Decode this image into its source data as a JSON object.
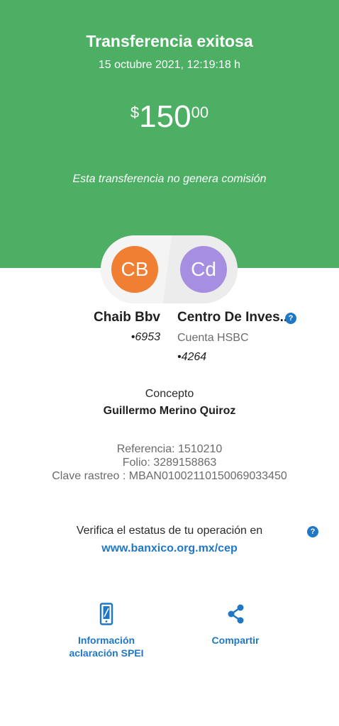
{
  "header": {
    "title": "Transferencia exitosa",
    "date": "15 octubre 2021, 12:19:18 h",
    "amount": {
      "currency": "$",
      "integer": "150",
      "decimal": "00"
    },
    "commission_note": "Esta transferencia no genera comisión",
    "bg_color": "#4caf64"
  },
  "sender": {
    "initials": "CB",
    "name": "Chaib Bbv",
    "account": "•6953",
    "avatar_color": "#f07e33"
  },
  "recipient": {
    "initials": "Cd",
    "name": "Centro De Inves...",
    "bank": "Cuenta HSBC",
    "account": "•4264",
    "avatar_color": "#a68fe0",
    "help_icon": "?"
  },
  "concept": {
    "label": "Concepto",
    "value": "Guillermo Merino Quiroz"
  },
  "references": {
    "referencia": "Referencia: 1510210",
    "folio": "Folio: 3289158863",
    "clave_rastreo": "Clave rastreo : MBAN01002110150069033450"
  },
  "verify": {
    "text": "Verifica el estatus de tu operación en",
    "link": "www.banxico.org.mx/cep",
    "help_icon": "?"
  },
  "actions": {
    "info": {
      "label_line1": "Información",
      "label_line2": "aclaración SPEI",
      "icon": "phone-icon"
    },
    "share": {
      "label": "Compartir",
      "icon": "share-icon"
    }
  },
  "colors": {
    "accent": "#1f77c5"
  }
}
